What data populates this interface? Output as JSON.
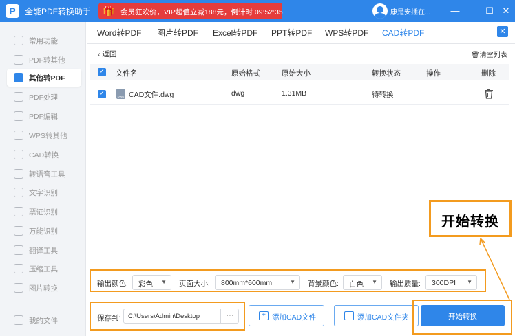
{
  "colors": {
    "primary": "#2f86e9",
    "promo": "#e53c3c",
    "highlight": "#f39b1f",
    "sidebar_bg": "#f2f4f7"
  },
  "titlebar": {
    "app_title": "全能PDF转换助手",
    "logo_glyph": "P",
    "promo_text": "会员狂欢价，VIP超值立减188元，倒计时 09:52:35",
    "user_name": "康是安插在...",
    "minimize": "—",
    "maximize": "☐",
    "close": "✕"
  },
  "sidebar": {
    "items": [
      {
        "label": "常用功能",
        "active": false
      },
      {
        "label": "PDF转其他",
        "active": false
      },
      {
        "label": "其他转PDF",
        "active": true
      },
      {
        "label": "PDF处理",
        "active": false
      },
      {
        "label": "PDF编辑",
        "active": false
      },
      {
        "label": "WPS转其他",
        "active": false
      },
      {
        "label": "CAD转换",
        "active": false
      },
      {
        "label": "转语音工具",
        "active": false
      },
      {
        "label": "文字识别",
        "active": false
      },
      {
        "label": "票证识别",
        "active": false
      },
      {
        "label": "万能识别",
        "active": false
      },
      {
        "label": "翻译工具",
        "active": false
      },
      {
        "label": "压缩工具",
        "active": false
      },
      {
        "label": "图片转换",
        "active": false
      }
    ],
    "my_files": "我的文件"
  },
  "tabs": [
    {
      "label": "Word转PDF",
      "active": false
    },
    {
      "label": "图片转PDF",
      "active": false
    },
    {
      "label": "Excel转PDF",
      "active": false
    },
    {
      "label": "PPT转PDF",
      "active": false
    },
    {
      "label": "WPS转PDF",
      "active": false
    },
    {
      "label": "CAD转PDF",
      "active": true
    }
  ],
  "toolbar": {
    "back_label": "返回",
    "clear_list_label": "清空列表"
  },
  "table": {
    "headers": {
      "name": "文件名",
      "format": "原始格式",
      "size": "原始大小",
      "status": "转换状态",
      "action": "操作",
      "delete": "删除"
    },
    "rows": [
      {
        "name": "CAD文件.dwg",
        "format": "dwg",
        "size": "1.31MB",
        "status": "待转换",
        "checked": true
      }
    ]
  },
  "options": {
    "color_label": "输出颜色:",
    "color_value": "彩色",
    "page_label": "页面大小:",
    "page_value": "800mm*600mm",
    "bg_label": "背景颜色:",
    "bg_value": "白色",
    "quality_label": "输出质量:",
    "quality_value": "300DPI"
  },
  "bottom": {
    "save_label": "保存到:",
    "save_path": "C:\\Users\\Admin\\Desktop",
    "browse": "···",
    "add_file": "添加CAD文件",
    "add_folder": "添加CAD文件夹",
    "start": "开始转换"
  },
  "callout": {
    "text": "开始转换"
  }
}
